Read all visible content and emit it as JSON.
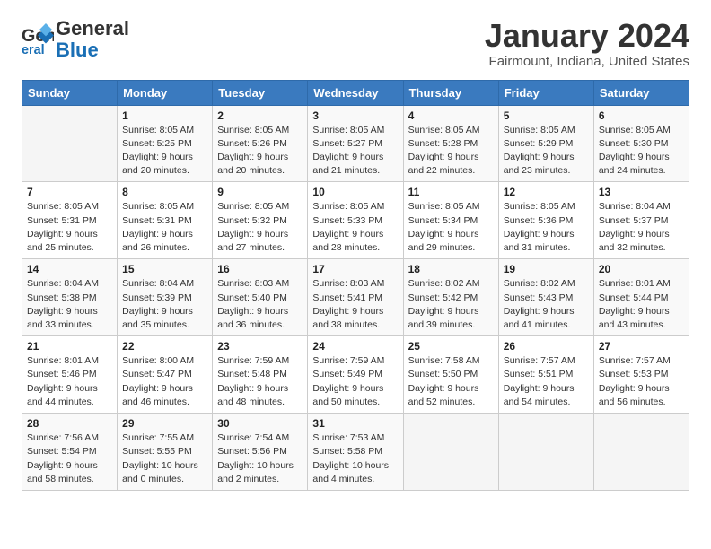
{
  "header": {
    "logo_general": "General",
    "logo_blue": "Blue",
    "title": "January 2024",
    "subtitle": "Fairmount, Indiana, United States"
  },
  "days_of_week": [
    "Sunday",
    "Monday",
    "Tuesday",
    "Wednesday",
    "Thursday",
    "Friday",
    "Saturday"
  ],
  "weeks": [
    [
      {
        "day": "",
        "detail": ""
      },
      {
        "day": "1",
        "detail": "Sunrise: 8:05 AM\nSunset: 5:25 PM\nDaylight: 9 hours\nand 20 minutes."
      },
      {
        "day": "2",
        "detail": "Sunrise: 8:05 AM\nSunset: 5:26 PM\nDaylight: 9 hours\nand 20 minutes."
      },
      {
        "day": "3",
        "detail": "Sunrise: 8:05 AM\nSunset: 5:27 PM\nDaylight: 9 hours\nand 21 minutes."
      },
      {
        "day": "4",
        "detail": "Sunrise: 8:05 AM\nSunset: 5:28 PM\nDaylight: 9 hours\nand 22 minutes."
      },
      {
        "day": "5",
        "detail": "Sunrise: 8:05 AM\nSunset: 5:29 PM\nDaylight: 9 hours\nand 23 minutes."
      },
      {
        "day": "6",
        "detail": "Sunrise: 8:05 AM\nSunset: 5:30 PM\nDaylight: 9 hours\nand 24 minutes."
      }
    ],
    [
      {
        "day": "7",
        "detail": "Sunrise: 8:05 AM\nSunset: 5:31 PM\nDaylight: 9 hours\nand 25 minutes."
      },
      {
        "day": "8",
        "detail": "Sunrise: 8:05 AM\nSunset: 5:31 PM\nDaylight: 9 hours\nand 26 minutes."
      },
      {
        "day": "9",
        "detail": "Sunrise: 8:05 AM\nSunset: 5:32 PM\nDaylight: 9 hours\nand 27 minutes."
      },
      {
        "day": "10",
        "detail": "Sunrise: 8:05 AM\nSunset: 5:33 PM\nDaylight: 9 hours\nand 28 minutes."
      },
      {
        "day": "11",
        "detail": "Sunrise: 8:05 AM\nSunset: 5:34 PM\nDaylight: 9 hours\nand 29 minutes."
      },
      {
        "day": "12",
        "detail": "Sunrise: 8:05 AM\nSunset: 5:36 PM\nDaylight: 9 hours\nand 31 minutes."
      },
      {
        "day": "13",
        "detail": "Sunrise: 8:04 AM\nSunset: 5:37 PM\nDaylight: 9 hours\nand 32 minutes."
      }
    ],
    [
      {
        "day": "14",
        "detail": "Sunrise: 8:04 AM\nSunset: 5:38 PM\nDaylight: 9 hours\nand 33 minutes."
      },
      {
        "day": "15",
        "detail": "Sunrise: 8:04 AM\nSunset: 5:39 PM\nDaylight: 9 hours\nand 35 minutes."
      },
      {
        "day": "16",
        "detail": "Sunrise: 8:03 AM\nSunset: 5:40 PM\nDaylight: 9 hours\nand 36 minutes."
      },
      {
        "day": "17",
        "detail": "Sunrise: 8:03 AM\nSunset: 5:41 PM\nDaylight: 9 hours\nand 38 minutes."
      },
      {
        "day": "18",
        "detail": "Sunrise: 8:02 AM\nSunset: 5:42 PM\nDaylight: 9 hours\nand 39 minutes."
      },
      {
        "day": "19",
        "detail": "Sunrise: 8:02 AM\nSunset: 5:43 PM\nDaylight: 9 hours\nand 41 minutes."
      },
      {
        "day": "20",
        "detail": "Sunrise: 8:01 AM\nSunset: 5:44 PM\nDaylight: 9 hours\nand 43 minutes."
      }
    ],
    [
      {
        "day": "21",
        "detail": "Sunrise: 8:01 AM\nSunset: 5:46 PM\nDaylight: 9 hours\nand 44 minutes."
      },
      {
        "day": "22",
        "detail": "Sunrise: 8:00 AM\nSunset: 5:47 PM\nDaylight: 9 hours\nand 46 minutes."
      },
      {
        "day": "23",
        "detail": "Sunrise: 7:59 AM\nSunset: 5:48 PM\nDaylight: 9 hours\nand 48 minutes."
      },
      {
        "day": "24",
        "detail": "Sunrise: 7:59 AM\nSunset: 5:49 PM\nDaylight: 9 hours\nand 50 minutes."
      },
      {
        "day": "25",
        "detail": "Sunrise: 7:58 AM\nSunset: 5:50 PM\nDaylight: 9 hours\nand 52 minutes."
      },
      {
        "day": "26",
        "detail": "Sunrise: 7:57 AM\nSunset: 5:51 PM\nDaylight: 9 hours\nand 54 minutes."
      },
      {
        "day": "27",
        "detail": "Sunrise: 7:57 AM\nSunset: 5:53 PM\nDaylight: 9 hours\nand 56 minutes."
      }
    ],
    [
      {
        "day": "28",
        "detail": "Sunrise: 7:56 AM\nSunset: 5:54 PM\nDaylight: 9 hours\nand 58 minutes."
      },
      {
        "day": "29",
        "detail": "Sunrise: 7:55 AM\nSunset: 5:55 PM\nDaylight: 10 hours\nand 0 minutes."
      },
      {
        "day": "30",
        "detail": "Sunrise: 7:54 AM\nSunset: 5:56 PM\nDaylight: 10 hours\nand 2 minutes."
      },
      {
        "day": "31",
        "detail": "Sunrise: 7:53 AM\nSunset: 5:58 PM\nDaylight: 10 hours\nand 4 minutes."
      },
      {
        "day": "",
        "detail": ""
      },
      {
        "day": "",
        "detail": ""
      },
      {
        "day": "",
        "detail": ""
      }
    ]
  ]
}
